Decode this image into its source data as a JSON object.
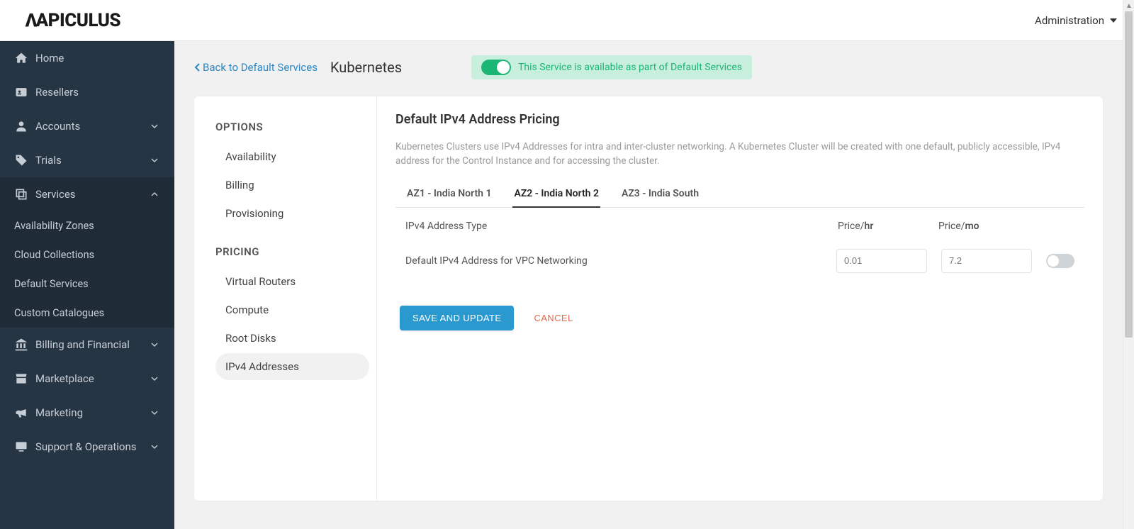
{
  "brand": "APICULUS",
  "top_right": {
    "label": "Administration"
  },
  "sidebar": {
    "items": [
      {
        "label": "Home"
      },
      {
        "label": "Resellers"
      },
      {
        "label": "Accounts"
      },
      {
        "label": "Trials"
      },
      {
        "label": "Services",
        "expanded": true,
        "children": [
          {
            "label": "Availability Zones"
          },
          {
            "label": "Cloud Collections"
          },
          {
            "label": "Default Services"
          },
          {
            "label": "Custom Catalogues"
          }
        ]
      },
      {
        "label": "Billing and Financial"
      },
      {
        "label": "Marketplace"
      },
      {
        "label": "Marketing"
      },
      {
        "label": "Support & Operations"
      }
    ]
  },
  "page": {
    "back_label": "Back to Default Services",
    "title": "Kubernetes",
    "availability_text": "This Service is available as part of Default Services"
  },
  "options_panel": {
    "heading_options": "OPTIONS",
    "heading_pricing": "PRICING",
    "options": [
      {
        "label": "Availability"
      },
      {
        "label": "Billing"
      },
      {
        "label": "Provisioning"
      }
    ],
    "pricing": [
      {
        "label": "Virtual Routers"
      },
      {
        "label": "Compute"
      },
      {
        "label": "Root Disks"
      },
      {
        "label": "IPv4 Addresses"
      }
    ]
  },
  "detail": {
    "title": "Default IPv4 Address Pricing",
    "description": "Kubernetes Clusters use IPv4 Addresses for intra and inter-cluster networking. A Kubernetes Cluster will be created with one default, publicly accessible, IPv4 address for the Control Instance and for accessing the cluster.",
    "tabs": [
      {
        "label": "AZ1 - India North 1"
      },
      {
        "label": "AZ2 - India North 2"
      },
      {
        "label": "AZ3 - India South"
      }
    ],
    "columns": {
      "type": "IPv4 Address Type",
      "price_prefix": "Price/",
      "hr": "hr",
      "mo": "mo"
    },
    "row": {
      "label": "Default IPv4 Address for VPC Networking",
      "price_hr_placeholder": "0.01",
      "price_mo_placeholder": "7.2"
    },
    "actions": {
      "save": "SAVE AND UPDATE",
      "cancel": "CANCEL"
    }
  }
}
